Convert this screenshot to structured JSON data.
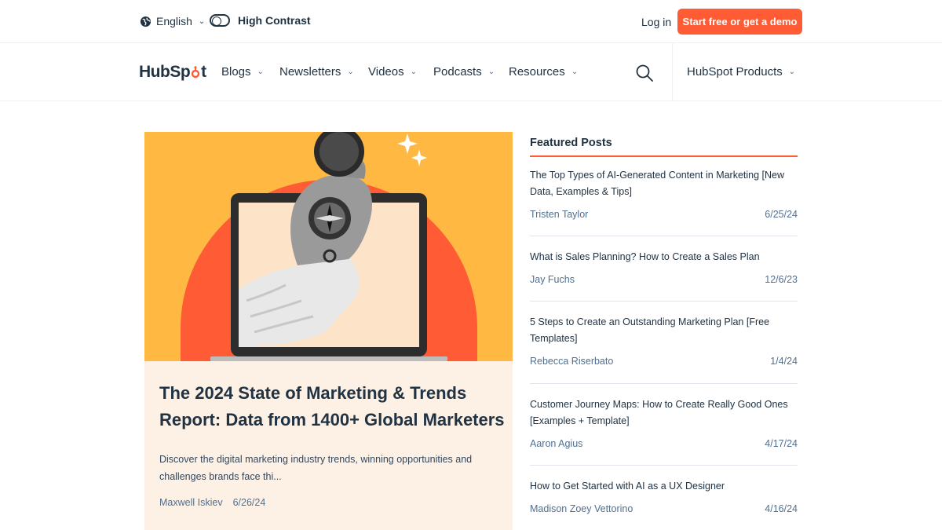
{
  "utility_bar": {
    "language": "English",
    "high_contrast_label": "High Contrast",
    "login_label": "Log in",
    "cta_label": "Start free or get a demo"
  },
  "nav": {
    "logo_text_a": "HubSp",
    "logo_text_b": "t",
    "items": [
      "Blogs",
      "Newsletters",
      "Videos",
      "Podcasts",
      "Resources"
    ],
    "products_label": "HubSpot Products"
  },
  "hero": {
    "title": "The 2024 State of Marketing & Trends Report: Data from 1400+ Global Marketers",
    "description": "Discover the digital marketing industry trends, winning opportunities and challenges brands face thi...",
    "author": "Maxwell Iskiev",
    "date": "6/26/24"
  },
  "featured": {
    "heading": "Featured Posts",
    "posts": [
      {
        "title": "The Top Types of AI-Generated Content in Marketing [New Data, Examples & Tips]",
        "author": "Tristen Taylor",
        "date": "6/25/24"
      },
      {
        "title": "What is Sales Planning? How to Create a Sales Plan",
        "author": "Jay Fuchs",
        "date": "12/6/23"
      },
      {
        "title": "5 Steps to Create an Outstanding Marketing Plan [Free Templates]",
        "author": "Rebecca Riserbato",
        "date": "1/4/24"
      },
      {
        "title": "Customer Journey Maps: How to Create Really Good Ones [Examples + Template]",
        "author": "Aaron Agius",
        "date": "4/17/24"
      },
      {
        "title": "How to Get Started with AI as a UX Designer",
        "author": "Madison Zoey Vettorino",
        "date": "4/16/24"
      }
    ]
  },
  "colors": {
    "accent": "#ff5c35",
    "text": "#213343",
    "hero_bg": "#ffb942",
    "card_bg": "#fdf1e6"
  }
}
